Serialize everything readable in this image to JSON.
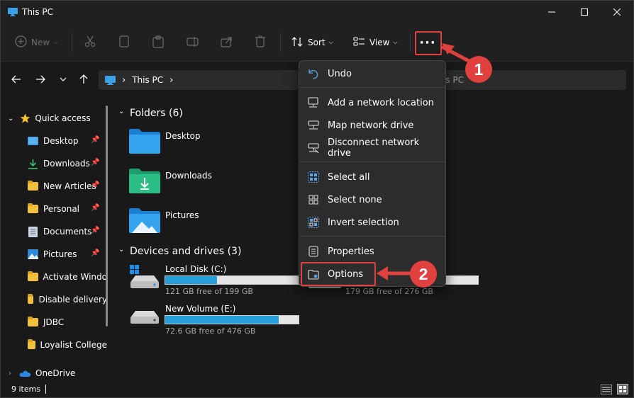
{
  "window": {
    "title": "This PC"
  },
  "toolbar": {
    "new_label": "New",
    "sort_label": "Sort",
    "view_label": "View",
    "more_label": "···"
  },
  "address": {
    "separator": "›",
    "location": "This PC",
    "search_hint": "is PC"
  },
  "sidebar": {
    "items": [
      {
        "label": "Quick access"
      },
      {
        "label": "Desktop"
      },
      {
        "label": "Downloads"
      },
      {
        "label": "New Articles"
      },
      {
        "label": "Personal"
      },
      {
        "label": "Documents"
      },
      {
        "label": "Pictures"
      },
      {
        "label": "Activate Windo"
      },
      {
        "label": "Disable delivery"
      },
      {
        "label": "JDBC"
      },
      {
        "label": "Loyalist College"
      },
      {
        "label": "OneDrive"
      }
    ]
  },
  "main": {
    "folders_header": "Folders (6)",
    "folders": [
      {
        "name": "Desktop"
      },
      {
        "name": "Downloads"
      },
      {
        "name": "Pictures"
      }
    ],
    "drives_header": "Devices and drives (3)",
    "drives": [
      {
        "name": "Local Disk (C:)",
        "free": "121 GB free of 199 GB",
        "used_fraction": 0.39
      },
      {
        "name": "",
        "free": "179 GB free of 276 GB",
        "used_fraction": 0.35
      },
      {
        "name": "New Volume (E:)",
        "free": "72.6 GB free of 476 GB",
        "used_fraction": 0.85
      }
    ]
  },
  "menu": {
    "items": [
      {
        "label": "Undo"
      },
      {
        "label": "Add a network location"
      },
      {
        "label": "Map network drive"
      },
      {
        "label": "Disconnect network drive"
      },
      {
        "label": "Select all"
      },
      {
        "label": "Select none"
      },
      {
        "label": "Invert selection"
      },
      {
        "label": "Properties"
      },
      {
        "label": "Options"
      }
    ]
  },
  "statusbar": {
    "count": "9 items"
  },
  "annotations": {
    "step1": "1",
    "step2": "2",
    "color": "#e0413e"
  },
  "colors": {
    "accent": "#26a0da",
    "folder": "#f3c13a",
    "background": "#191919"
  }
}
